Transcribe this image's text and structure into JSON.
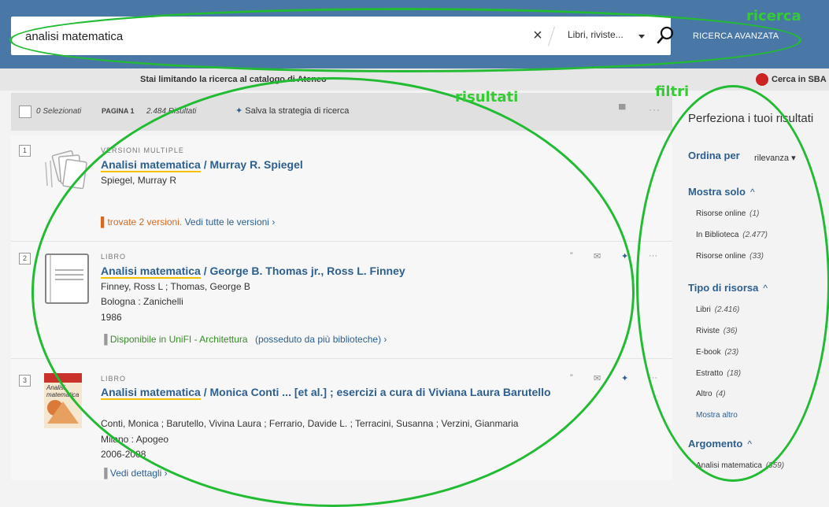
{
  "search": {
    "query": "analisi matematica",
    "clear_glyph": "×",
    "scope_label": "Libri, riviste...",
    "advanced_label": "RICERCA AVANZATA"
  },
  "annotations": {
    "ricerca": "ricerca",
    "risultati": "risultati",
    "filtri": "filtri"
  },
  "notice": {
    "text": "Stai limitando la ricerca al catalogo di Ateneo",
    "sba_label": "Cerca in SBA"
  },
  "toolbar": {
    "selected": "0 Selezionati",
    "page_label": "PAGINA 1",
    "results_count": "2.484 Risultati",
    "save_strategy": "Salva la strategia di ricerca"
  },
  "results": [
    {
      "num": "1",
      "type": "VERSIONI MULTIPLE",
      "title_hl": "Analisi matematica",
      "title_rest": " / Murray R. Spiegel",
      "author": "Spiegel, Murray R",
      "link_prefix": "trovate 2 versioni.",
      "link_text": "Vedi tutte le versioni",
      "link_chevron": "›"
    },
    {
      "num": "2",
      "type": "LIBRO",
      "title_hl": "Analisi matematica",
      "title_rest": " / George B. Thomas jr., Ross L. Finney",
      "author": "Finney, Ross L ; Thomas, George B",
      "publisher": "Bologna : Zanichelli",
      "year": "1986",
      "avail": "Disponibile in UniFI - Architettura",
      "avail_extra": "(posseduto da più biblioteche)",
      "link_chevron": "›"
    },
    {
      "num": "3",
      "type": "LIBRO",
      "title_hl": "Analisi matematica",
      "title_rest": " / Monica Conti ... [et al.] ; esercizi a cura di Viviana Laura Barutello",
      "author": "Conti, Monica ; Barutello, Vivina Laura ; Ferrario, Davide L. ; Terracini, Susanna ; Verzini, Gianmaria",
      "publisher": "Milano : Apogeo",
      "year": "2006-2008",
      "link_text": "Vedi dettagli",
      "link_chevron": "›",
      "thumb_text": "Analisi matematica"
    }
  ],
  "sidebar": {
    "title": "Perfeziona i tuoi risultati",
    "sort_label": "Ordina per",
    "sort_value": "rilevanza",
    "show_only": {
      "heading": "Mostra solo",
      "chevron": "^",
      "items": [
        {
          "label": "Risorse online",
          "count": "(1)"
        },
        {
          "label": "In Biblioteca",
          "count": "(2.477)"
        },
        {
          "label": "Risorse online",
          "count": "(33)"
        }
      ]
    },
    "resource_type": {
      "heading": "Tipo di risorsa",
      "chevron": "^",
      "items": [
        {
          "label": "Libri",
          "count": "(2.416)"
        },
        {
          "label": "Riviste",
          "count": "(36)"
        },
        {
          "label": "E-book",
          "count": "(23)"
        },
        {
          "label": "Estratto",
          "count": "(18)"
        },
        {
          "label": "Altro",
          "count": "(4)"
        }
      ],
      "more": "Mostra altro"
    },
    "subject": {
      "heading": "Argomento",
      "chevron": "^",
      "items": [
        {
          "label": "Analisi matematica",
          "count": "(359)"
        }
      ]
    }
  },
  "colors": {
    "topbar": "#4a78a6",
    "link": "#2d5f8f",
    "annotation": "#33cc33",
    "highlight": "#f2c200",
    "available": "#3a8a2a",
    "versions": "#d9681f"
  }
}
